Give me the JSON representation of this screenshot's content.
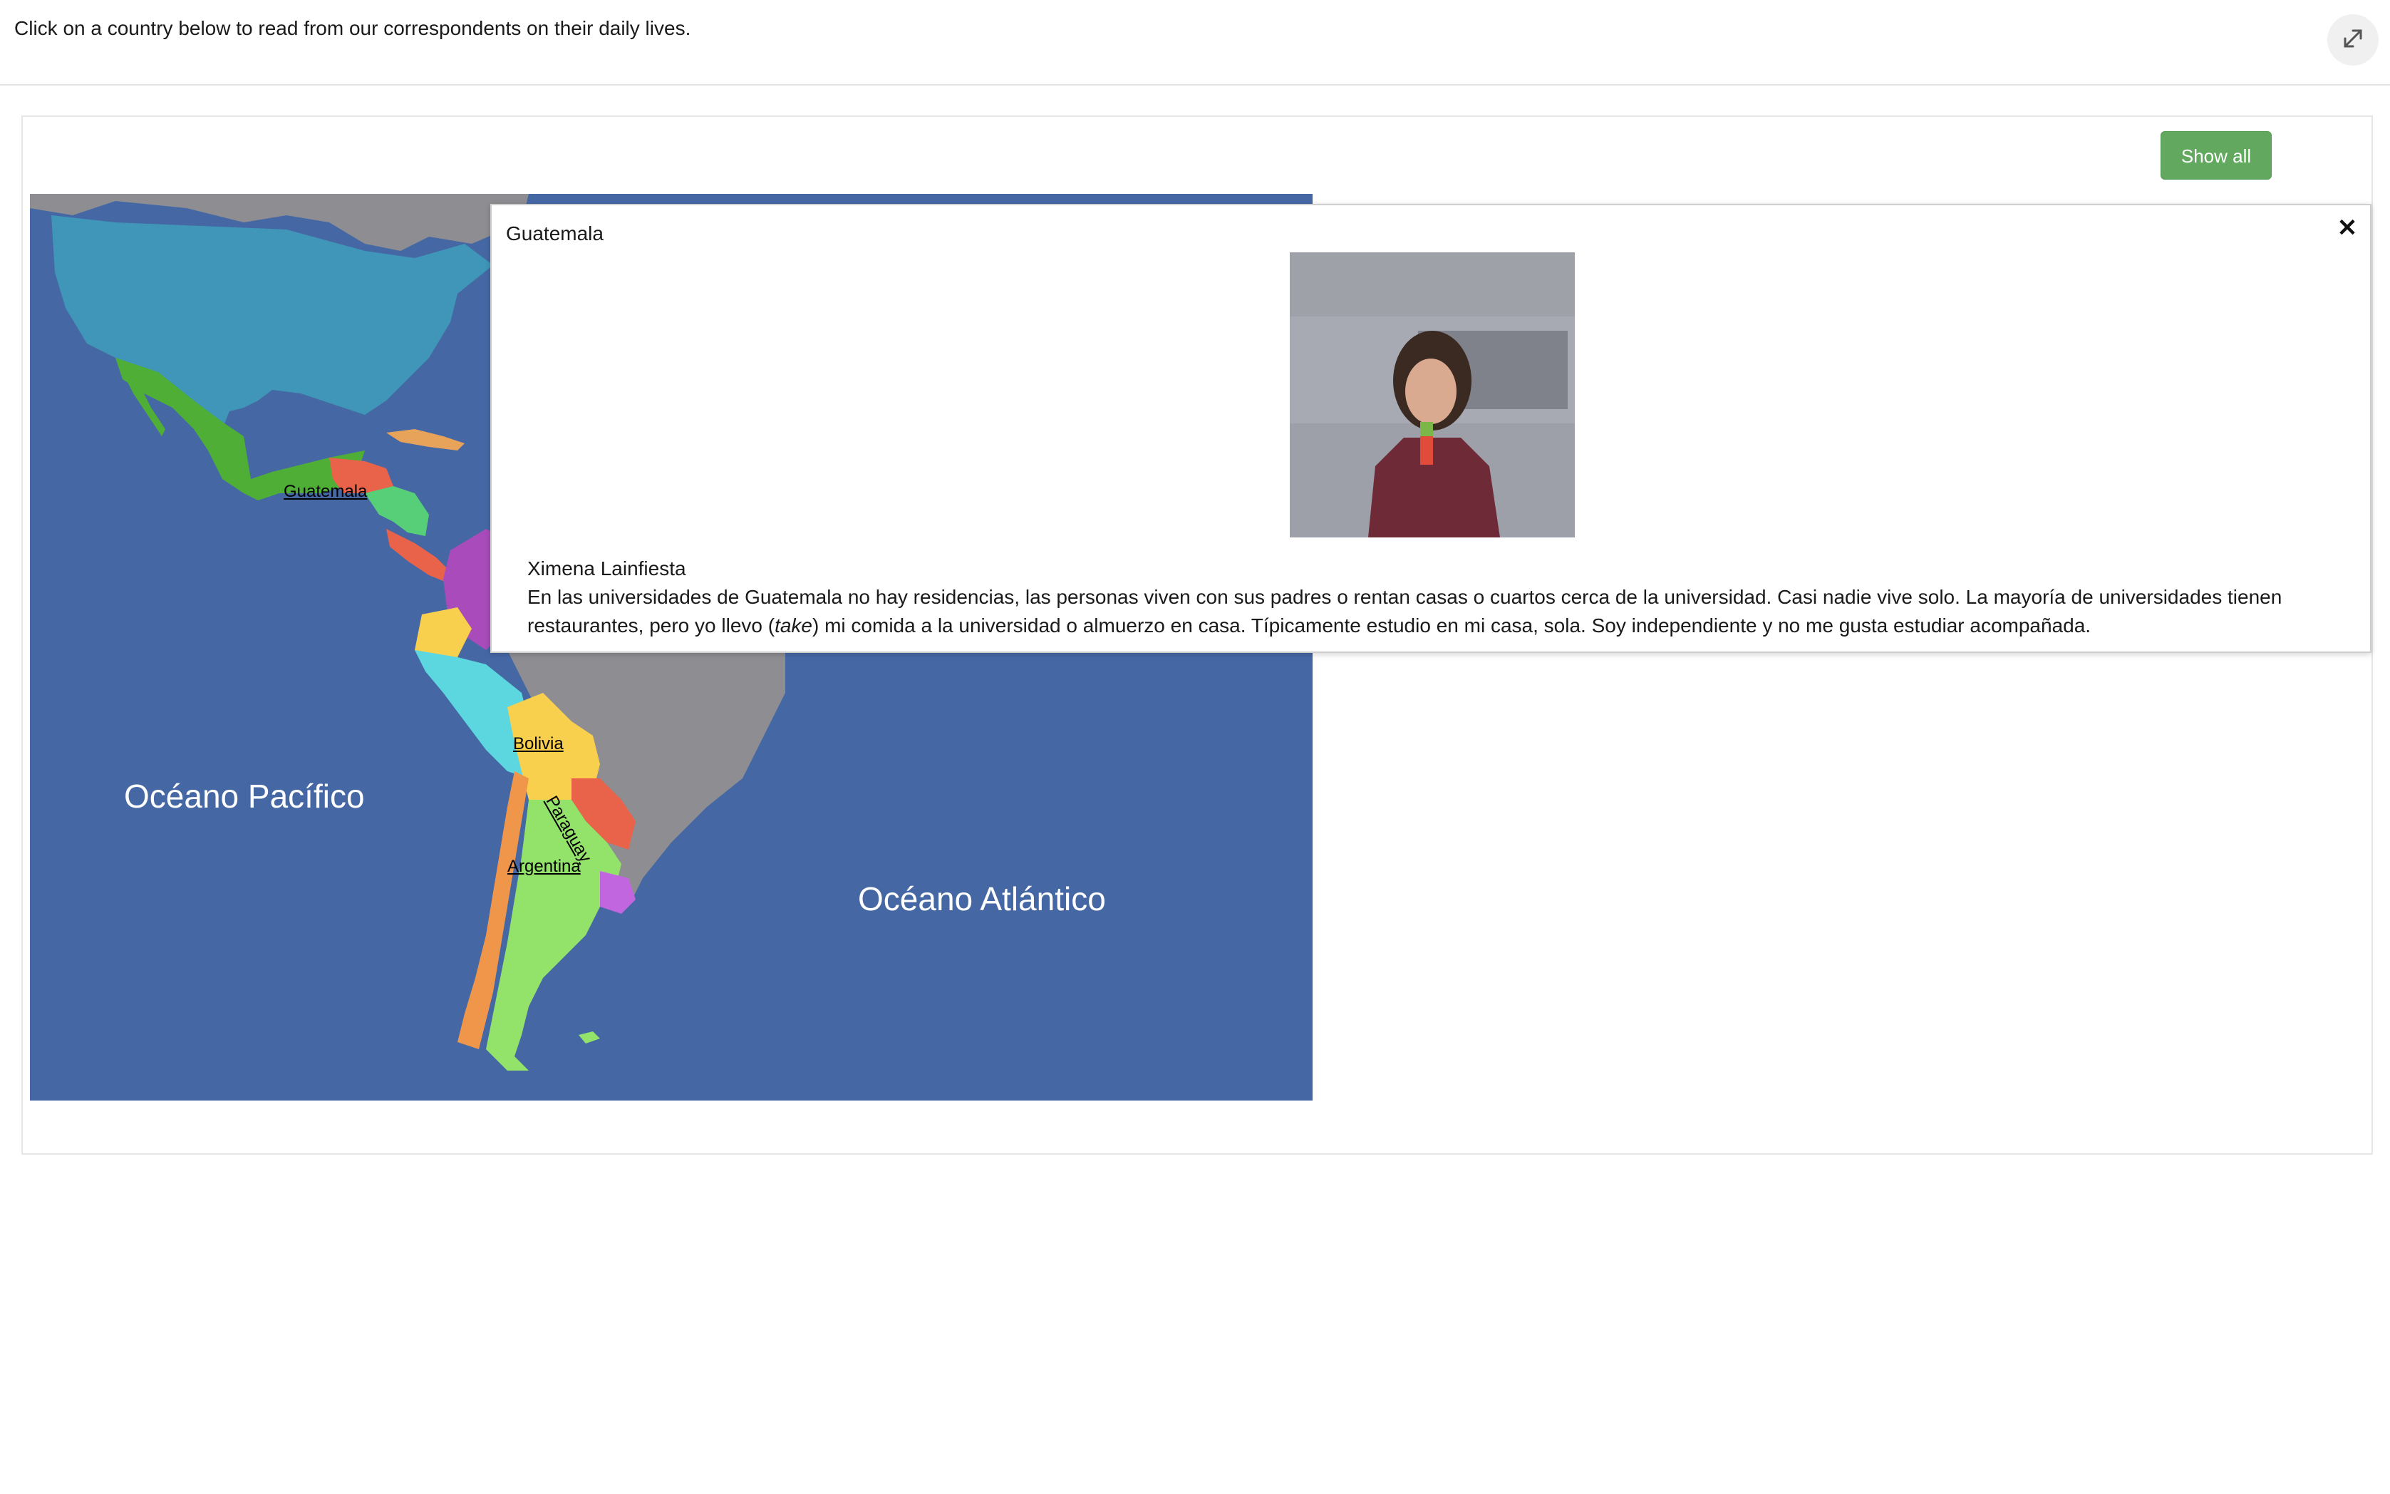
{
  "header": {
    "instructions": "Click on a country below to read from our correspondents on their daily lives.",
    "fullscreen_icon": "expand-arrows-icon"
  },
  "controls": {
    "show_all_label": "Show all",
    "show_all_color": "#62a85f"
  },
  "map": {
    "ocean_color": "#4568a4",
    "labels": {
      "guatemala": "Guatemala",
      "bolivia": "Bolivia",
      "paraguay": "Paraguay",
      "argentina": "Argentina"
    },
    "oceans": {
      "pacific": "Océano Pacífico",
      "atlantic": "Océano Atlántico"
    }
  },
  "popup": {
    "title": "Guatemala",
    "close_icon": "close-icon",
    "photo_icon": "correspondent-photo",
    "correspondent_name": "Ximena Lainfiesta",
    "text_before": "En las universidades de Guatemala no hay residencias, las personas viven con sus padres o rentan casas o cuartos cerca de la universidad. Casi nadie vive solo. La mayoría de universidades tienen restaurantes, pero yo llevo (",
    "text_italic": "take",
    "text_after": ") mi comida a la universidad o almuerzo en casa. Típicamente estudio en mi casa, sola. Soy independiente y no me gusta estudiar acompañada."
  }
}
